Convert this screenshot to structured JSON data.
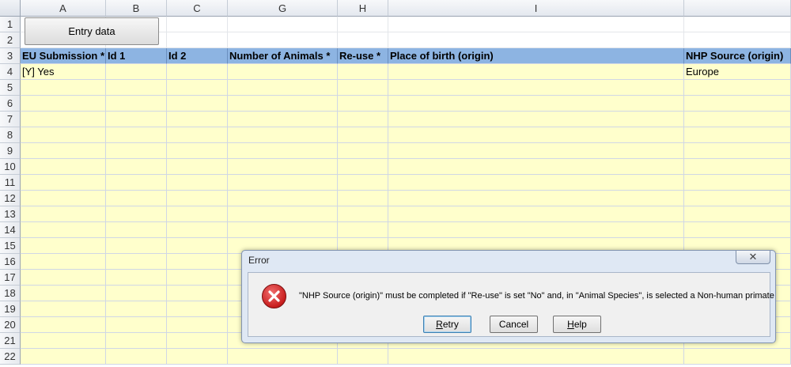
{
  "sheet": {
    "columns": [
      "A",
      "B",
      "C",
      "G",
      "H",
      "I",
      ""
    ],
    "rows": [
      "1",
      "2",
      "3",
      "4",
      "5",
      "6",
      "7",
      "8",
      "9",
      "10",
      "11",
      "12",
      "13",
      "14",
      "15",
      "16",
      "17",
      "18",
      "19",
      "20",
      "21",
      "22"
    ],
    "header_row": [
      "EU Submission *",
      "Id 1",
      "Id 2",
      "Number of Animals *",
      "Re-use *",
      "Place of birth (origin)",
      "NHP Source (origin)"
    ],
    "data_row_4": [
      "[Y] Yes",
      "",
      "",
      "",
      "",
      "",
      "Europe"
    ]
  },
  "entry_button": {
    "label": "Entry data"
  },
  "dialog": {
    "title": "Error",
    "close_label": "✕",
    "message": "\"NHP Source (origin)\" must be completed if  \"Re-use\" is set \"No\" and, in \"Animal Species\", is selected a Non-human primate",
    "buttons": {
      "retry": {
        "accel": "R",
        "rest": "etry"
      },
      "cancel": {
        "label": "Cancel"
      },
      "help": {
        "accel": "H",
        "rest": "elp"
      }
    }
  },
  "colors": {
    "header_fill": "#8db4e2",
    "data_fill": "#ffffcc",
    "error_icon": "#c81e1e"
  }
}
